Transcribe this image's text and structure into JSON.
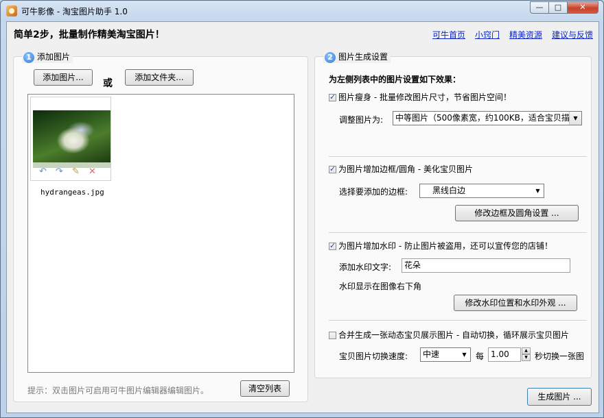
{
  "window": {
    "title": "可牛影像 - 淘宝图片助手 1.0",
    "controls": {
      "minimize": "—",
      "maximize": "□",
      "close": "✕"
    }
  },
  "header": {
    "headline": "简单2步，批量制作精美淘宝图片！",
    "links": [
      "可牛首页",
      "小窍门",
      "精美资源",
      "建议与反馈"
    ]
  },
  "step1": {
    "number": "1",
    "title": "添加图片",
    "add_image_button": "添加图片...",
    "or_label": "或",
    "add_folder_button": "添加文件夹...",
    "images": [
      {
        "filename": "hydrangeas.jpg",
        "icons": [
          "rotate-left-icon",
          "rotate-right-icon",
          "edit-icon",
          "delete-icon"
        ]
      }
    ],
    "hint": "提示：双击图片可启用可牛图片编辑器编辑图片。",
    "clear_button": "清空列表"
  },
  "step2": {
    "number": "2",
    "title": "图片生成设置",
    "intro": "为左侧列表中的图片设置如下效果：",
    "resize": {
      "checked": true,
      "label": "图片瘦身 - 批量修改图片尺寸，节省图片空间！",
      "size_label": "调整图片为:",
      "size_value": "中等图片（500像素宽，约100KB，适合宝贝描述"
    },
    "border": {
      "checked": true,
      "label": "为图片增加边框/圆角 - 美化宝贝图片",
      "select_label": "选择要添加的边框:",
      "select_value": "黑线白边",
      "settings_button": "修改边框及圆角设置 ..."
    },
    "watermark": {
      "checked": true,
      "label": "为图片增加水印 - 防止图片被盗用，还可以宣传您的店铺！",
      "text_label": "添加水印文字:",
      "text_value": "花朵",
      "position_text": "水印显示在图像右下角",
      "settings_button": "修改水印位置和水印外观 ..."
    },
    "animation": {
      "checked": false,
      "label": "合并生成一张动态宝贝展示图片 - 自动切换，循环展示宝贝图片",
      "speed_label": "宝贝图片切换速度:",
      "speed_value": "中速",
      "every_label": "每",
      "interval_value": "1.00",
      "interval_suffix": "秒切换一张图"
    }
  },
  "generate_button": "生成图片 ..."
}
